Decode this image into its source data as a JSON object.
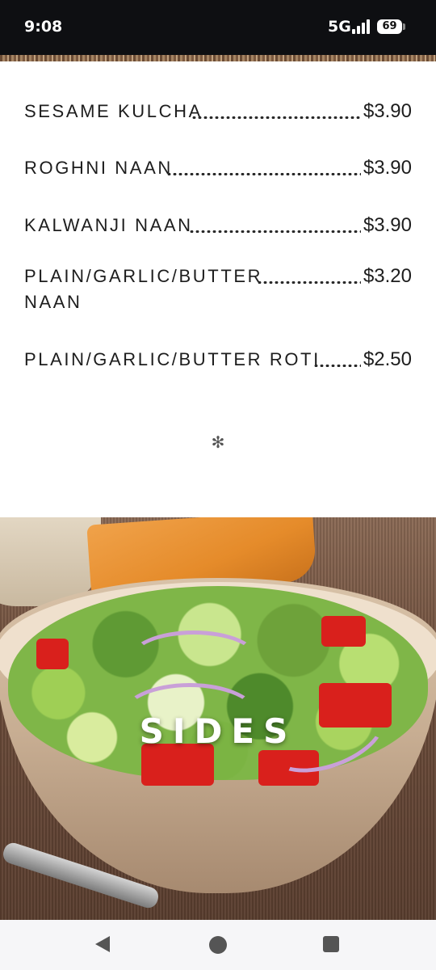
{
  "status_bar": {
    "time": "9:08",
    "network": "5G",
    "signal_icon": "signal-bars-icon",
    "battery_level": "69",
    "battery_icon": "battery-icon"
  },
  "menu": {
    "items": [
      {
        "name": "SESAME KULCHA",
        "name_line2": "",
        "price": "$3.90"
      },
      {
        "name": "ROGHNI NAAN",
        "name_line2": "",
        "price": "$3.90"
      },
      {
        "name": "KALWANJI NAAN",
        "name_line2": "",
        "price": "$3.90"
      },
      {
        "name": "PLAIN/GARLIC/BUTTER",
        "name_line2": "NAAN",
        "price": "$3.20"
      },
      {
        "name": "PLAIN/GARLIC/BUTTER ROTI",
        "name_line2": "",
        "price": "$2.50"
      }
    ],
    "ornament": "✻"
  },
  "section": {
    "title": "SIDES",
    "image": "salad-bowl-image"
  },
  "nav_bar": {
    "back_icon": "back-triangle-icon",
    "home_icon": "home-circle-icon",
    "recents_icon": "recents-square-icon"
  },
  "colors": {
    "status_bar_bg": "#0e0f12",
    "text": "#1d1d1d",
    "nav_bar_bg": "#f6f6f8"
  }
}
